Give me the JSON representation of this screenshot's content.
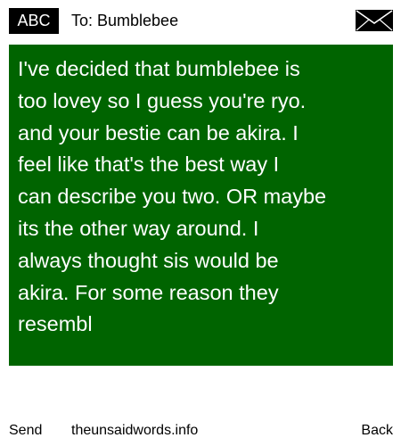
{
  "header": {
    "mode_badge": "ABC",
    "recipient": "To: Bumblebee",
    "icon": "envelope-icon"
  },
  "message": {
    "lines": [
      "I've decided that bumblebee is",
      "too lovey so I guess you're ryo.",
      "and your bestie can be akira. I",
      "feel like that's the best way I",
      "can describe you two. OR maybe",
      "its the other way around. I",
      "always thought sis would be",
      "akira. For some reason they",
      "resembl"
    ]
  },
  "footer": {
    "send_label": "Send",
    "site_label": "theunsaidwords.info",
    "back_label": "Back"
  },
  "colors": {
    "message_background": "#006400",
    "message_text": "#ffffff",
    "badge_background": "#000000",
    "page_background": "#ffffff"
  }
}
